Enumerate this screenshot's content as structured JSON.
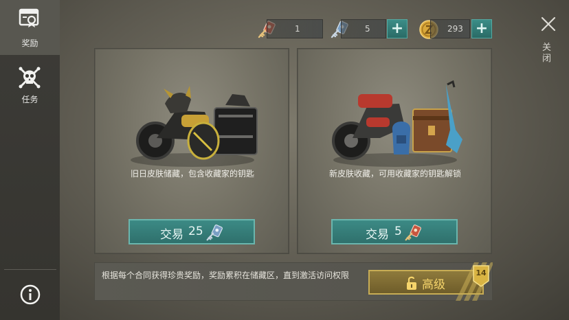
{
  "sidebar": {
    "items": [
      {
        "label": "奖励",
        "icon": "reward-card-icon",
        "active": true
      },
      {
        "label": "任务",
        "icon": "skull-crossbones-icon",
        "active": false
      }
    ],
    "info_icon": "info-icon"
  },
  "currency": {
    "red_key": {
      "value": "1",
      "icon": "red-key-icon"
    },
    "blue_key": {
      "value": "5",
      "icon": "blue-key-icon"
    },
    "coins": {
      "value": "293",
      "icon": "gold-coin-icon"
    },
    "plus_label": "+"
  },
  "close": {
    "label": "关闭",
    "icon": "close-icon"
  },
  "cards": [
    {
      "description": "旧日皮肤储藏，包含收藏家的钥匙",
      "trade_label": "交易",
      "trade_cost": "25",
      "cost_icon": "blue-key-icon",
      "art": "dark-motorcycle-with-crates"
    },
    {
      "description": "新皮肤收藏，可用收藏家的钥匙解锁",
      "trade_label": "交易",
      "trade_cost": "5",
      "cost_icon": "red-key-icon",
      "art": "red-motorcycle-with-guitar-and-chest"
    }
  ],
  "footer": {
    "text": "根据每个合同获得珍贵奖励，奖励累积在储藏区，直到激活访问权限",
    "advanced_label": "高级",
    "badge_level": "14"
  },
  "colors": {
    "teal_button": "#3c8a85",
    "gold_button": "#8e7a3c",
    "gold_text": "#f6d56b",
    "sidebar": "#3d3c38"
  }
}
